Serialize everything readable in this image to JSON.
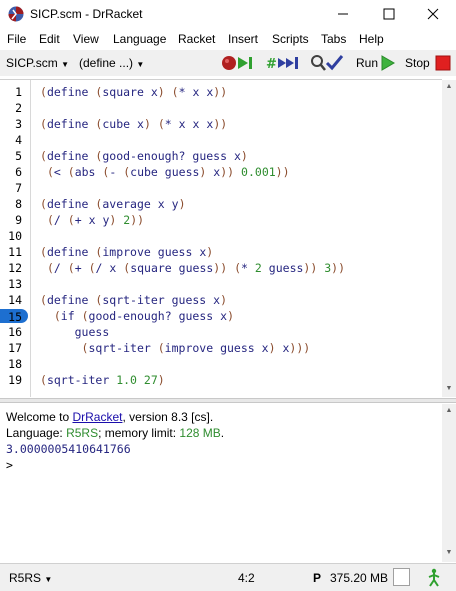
{
  "window": {
    "title": "SICP.scm - DrRacket"
  },
  "menu": [
    "File",
    "Edit",
    "View",
    "Language",
    "Racket",
    "Insert",
    "Scripts",
    "Tabs",
    "Help"
  ],
  "toolbar": {
    "file_selector": "SICP.scm",
    "define_selector": "(define ...)",
    "run_label": "Run",
    "stop_label": "Stop"
  },
  "editor": {
    "breakpoint_line": 15,
    "lines": [
      {
        "n": "1",
        "code": "(define (square x) (* x x))"
      },
      {
        "n": "2",
        "code": ""
      },
      {
        "n": "3",
        "code": "(define (cube x) (* x x x))"
      },
      {
        "n": "4",
        "code": ""
      },
      {
        "n": "5",
        "code": "(define (good-enough? guess x)"
      },
      {
        "n": "6",
        "code": " (< (abs (- (cube guess) x)) 0.001))"
      },
      {
        "n": "7",
        "code": ""
      },
      {
        "n": "8",
        "code": "(define (average x y)"
      },
      {
        "n": "9",
        "code": " (/ (+ x y) 2))"
      },
      {
        "n": "10",
        "code": ""
      },
      {
        "n": "11",
        "code": "(define (improve guess x)"
      },
      {
        "n": "12",
        "code": " (/ (+ (/ x (square guess)) (* 2 guess)) 3))"
      },
      {
        "n": "13",
        "code": ""
      },
      {
        "n": "14",
        "code": "(define (sqrt-iter guess x)"
      },
      {
        "n": "15",
        "code": "  (if (good-enough? guess x)"
      },
      {
        "n": "16",
        "code": "     guess"
      },
      {
        "n": "17",
        "code": "      (sqrt-iter (improve guess x) x)))"
      },
      {
        "n": "18",
        "code": ""
      },
      {
        "n": "19",
        "code": "(sqrt-iter 1.0 27)"
      }
    ]
  },
  "repl": {
    "welcome_prefix": "Welcome to ",
    "welcome_link": "DrRacket",
    "welcome_suffix": ", version 8.3 [cs].",
    "language_prefix": "Language: ",
    "language_name": "R5RS",
    "memory_prefix": "; memory limit: ",
    "memory_limit": "128 MB",
    "memory_suffix": ".",
    "result": "3.0000005410641766",
    "prompt": ">"
  },
  "status": {
    "language": "R5RS",
    "position": "4:2",
    "p_indicator": "P",
    "memory": "375.20 MB"
  }
}
